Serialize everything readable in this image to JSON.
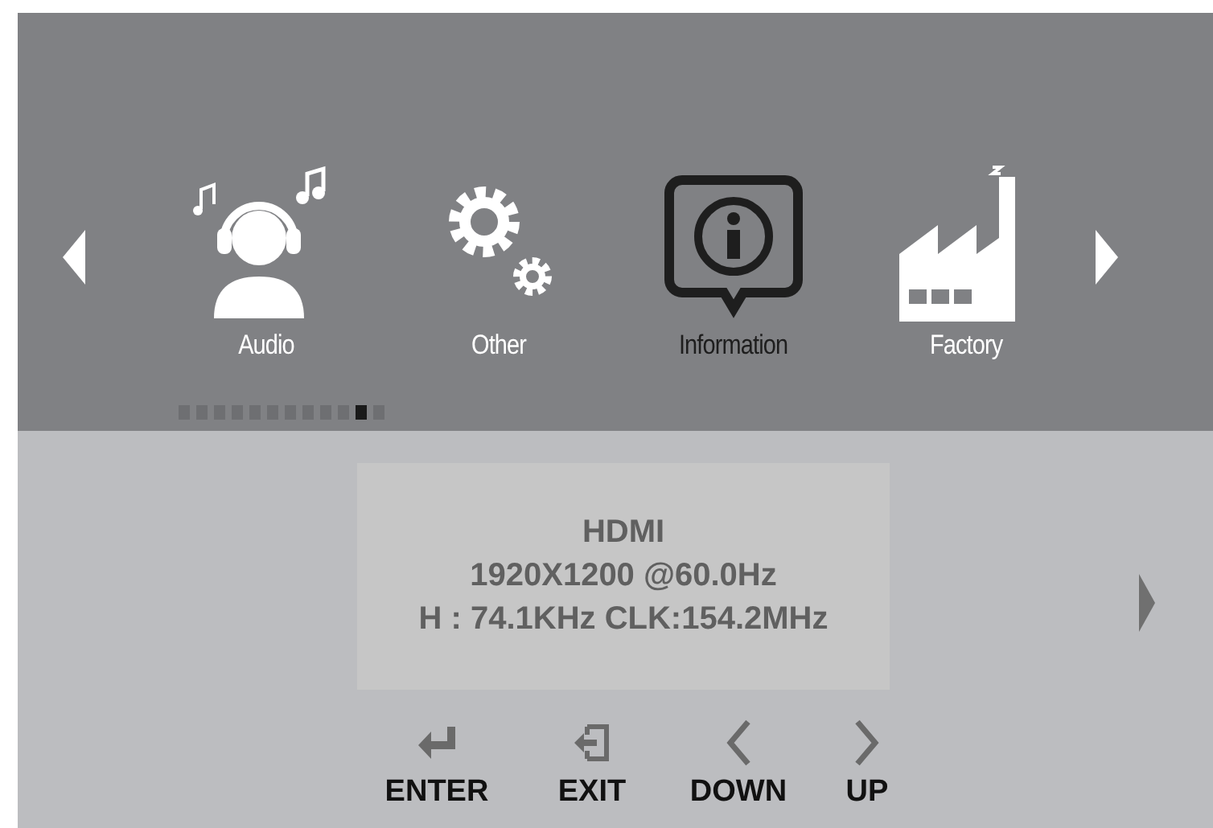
{
  "menu": [
    {
      "kind": "audio",
      "label": "Audio",
      "selected": false
    },
    {
      "kind": "other",
      "label": "Other",
      "selected": false
    },
    {
      "kind": "information",
      "label": "Information",
      "selected": true
    },
    {
      "kind": "factory",
      "label": "Factory",
      "selected": false
    }
  ],
  "pages": [
    {
      "selected": false
    },
    {
      "selected": false
    },
    {
      "selected": false
    },
    {
      "selected": false
    },
    {
      "selected": false
    },
    {
      "selected": false
    },
    {
      "selected": false
    },
    {
      "selected": false
    },
    {
      "selected": false
    },
    {
      "selected": false
    },
    {
      "selected": true
    },
    {
      "selected": false
    }
  ],
  "info": [
    "HDMI",
    "1920X1200 @60.0Hz",
    "H : 74.1KHz CLK:154.2MHz"
  ],
  "keys": [
    {
      "kind": "enter",
      "label": "ENTER"
    },
    {
      "kind": "exit",
      "label": "EXIT"
    },
    {
      "kind": "down",
      "label": "DOWN"
    },
    {
      "kind": "up",
      "label": "UP"
    }
  ]
}
